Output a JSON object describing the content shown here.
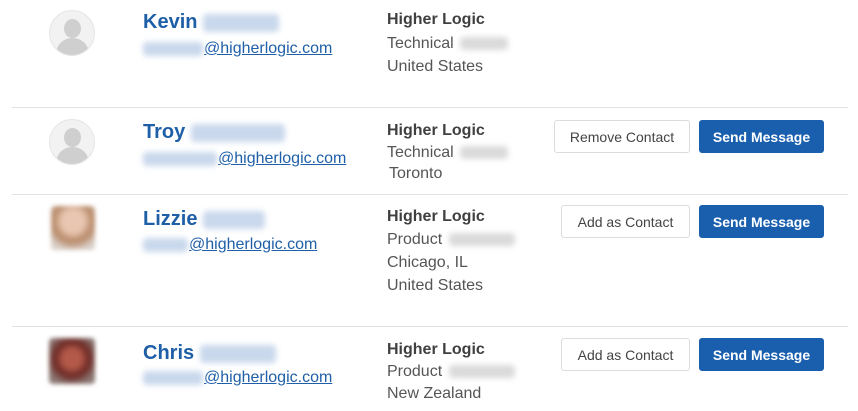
{
  "contacts": [
    {
      "first_name": "Kevin",
      "email_domain": "@higherlogic.com",
      "company": "Higher Logic",
      "title_prefix": "Technical",
      "location_lines": [
        "United States"
      ],
      "contact_button": null,
      "message_button": null
    },
    {
      "first_name": "Troy",
      "email_domain": "@higherlogic.com",
      "company": "Higher Logic",
      "title_prefix": "Technical",
      "location_lines": [
        "Toronto"
      ],
      "contact_button": "Remove Contact",
      "message_button": "Send Message"
    },
    {
      "first_name": "Lizzie",
      "email_domain": "@higherlogic.com",
      "company": "Higher Logic",
      "title_prefix": "Product",
      "location_lines": [
        "Chicago, IL",
        "United States"
      ],
      "contact_button": "Add as Contact",
      "message_button": "Send Message"
    },
    {
      "first_name": "Chris",
      "email_domain": "@higherlogic.com",
      "company": "Higher Logic",
      "title_prefix": "Product",
      "location_lines": [
        "New Zealand"
      ],
      "contact_button": "Add as Contact",
      "message_button": "Send Message"
    }
  ],
  "colors": {
    "link": "#1f5fa8",
    "primary_button": "#1a5fae",
    "divider": "#e3e3e3"
  },
  "icons": {
    "placeholder_avatar": "default-user-avatar-icon"
  }
}
